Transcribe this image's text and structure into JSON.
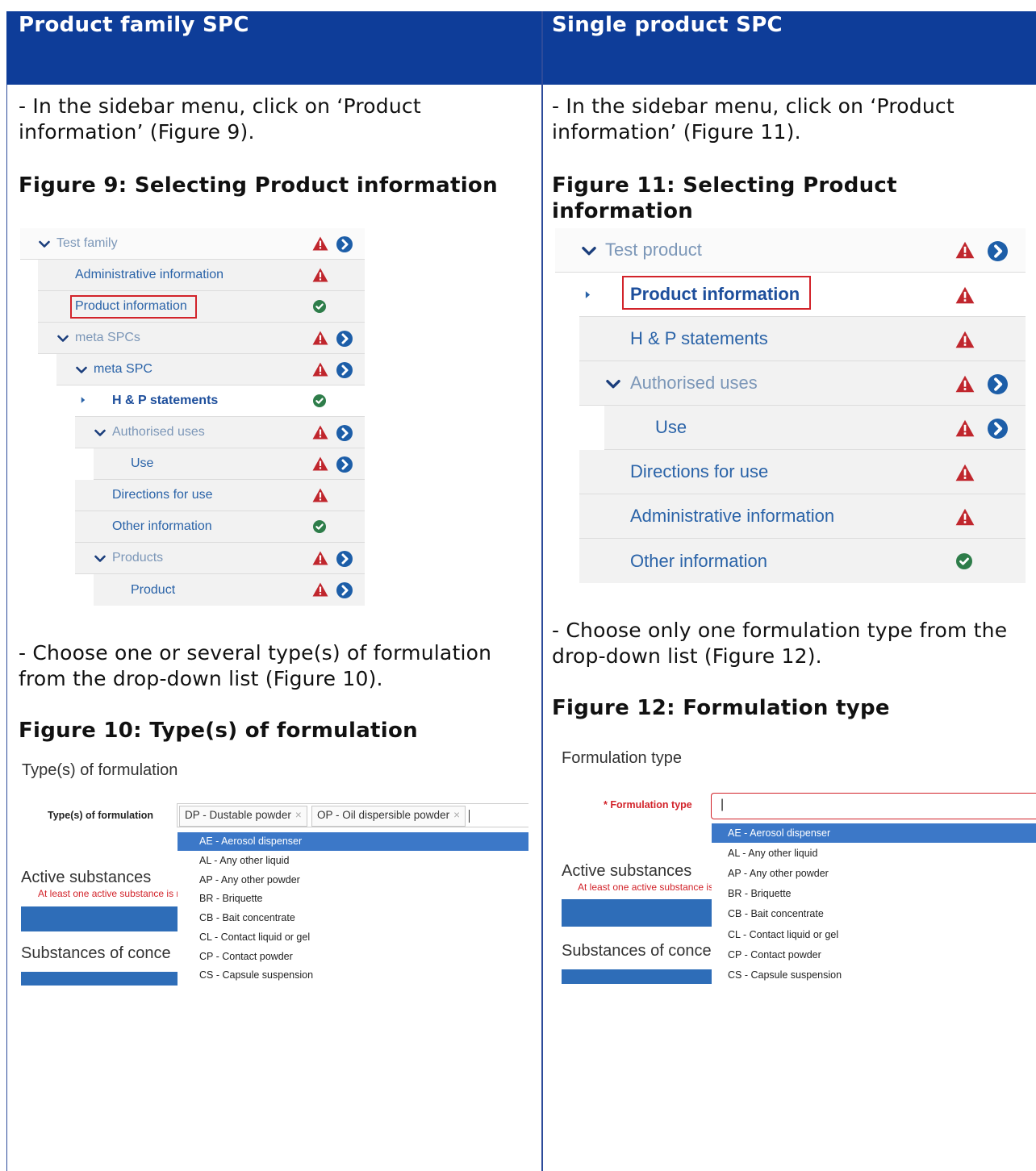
{
  "header": {
    "left_title": "Product family SPC",
    "right_title": "Single product SPC"
  },
  "left": {
    "intro": "- In the sidebar menu,  click on ‘Product information’  (Figure  9).",
    "figure9_title": "Figure  9: Selecting Product  information",
    "tree": [
      {
        "label": "Test family"
      },
      {
        "label": "Administrative information"
      },
      {
        "label": "Product information"
      },
      {
        "label": "meta SPCs"
      },
      {
        "label": "meta SPC"
      },
      {
        "label": "H & P statements"
      },
      {
        "label": "Authorised uses"
      },
      {
        "label": "Use"
      },
      {
        "label": "Directions for use"
      },
      {
        "label": "Other information"
      },
      {
        "label": "Products"
      },
      {
        "label": "Product"
      }
    ],
    "choose_text": "- Choose one or several type(s) of formulation from the drop-down list (Figure 10).",
    "figure10_title": "Figure  10: Type(s) of formulation",
    "form": {
      "section_title": "Type(s) of formulation",
      "field_label": "Type(s) of formulation",
      "tags": [
        "DP - Dustable powder",
        "OP - Oil dispersible powder"
      ],
      "tag_remove": "×",
      "active_substances": "Active substances",
      "warning": "At least one active substance is req",
      "substances_concern": "Substances of conce",
      "options": [
        "AE - Aerosol dispenser",
        "AL - Any other liquid",
        "AP - Any other powder",
        "BR - Briquette",
        "CB - Bait concentrate",
        "CL - Contact liquid or gel",
        "CP - Contact powder",
        "CS - Capsule suspension"
      ]
    }
  },
  "right": {
    "intro": "- In the sidebar menu,  click on ‘Product information’  (Figure  11).",
    "figure11_title": "Figure  11: Selecting Product information",
    "tree": [
      {
        "label": "Test product"
      },
      {
        "label": "Product information"
      },
      {
        "label": "H & P statements"
      },
      {
        "label": "Authorised uses"
      },
      {
        "label": "Use"
      },
      {
        "label": "Directions for use"
      },
      {
        "label": "Administrative information"
      },
      {
        "label": "Other information"
      }
    ],
    "choose_text": "- Choose only one formulation  type from the drop-down list (Figure  12).",
    "figure12_title": "Figure  12: Formulation  type",
    "form": {
      "section_title": "Formulation type",
      "field_label": "* Formulation type",
      "input_value": "|",
      "active_substances": "Active substances",
      "warning": "At least one active substance is re",
      "substances_concern": "Substances of conce",
      "options": [
        "AE - Aerosol dispenser",
        "AL - Any other liquid",
        "AP - Any other powder",
        "BR - Briquette",
        "CB - Bait concentrate",
        "CL - Contact liquid or gel",
        "CP - Contact powder",
        "CS - Capsule suspension"
      ]
    }
  },
  "icons": {
    "warning": "warning-triangle-icon",
    "arrow": "arrow-circle-icon",
    "check": "check-circle-icon",
    "chevron": "chevron-down-icon",
    "caret": "caret-right-icon"
  },
  "colors": {
    "header_bg": "#0e3d99",
    "link": "#2a63a8",
    "warning": "#c0262d",
    "check": "#2e8b4a",
    "arrow": "#1d5ea8",
    "highlight_box": "#d2232a",
    "selected_option": "#3c78c8"
  }
}
